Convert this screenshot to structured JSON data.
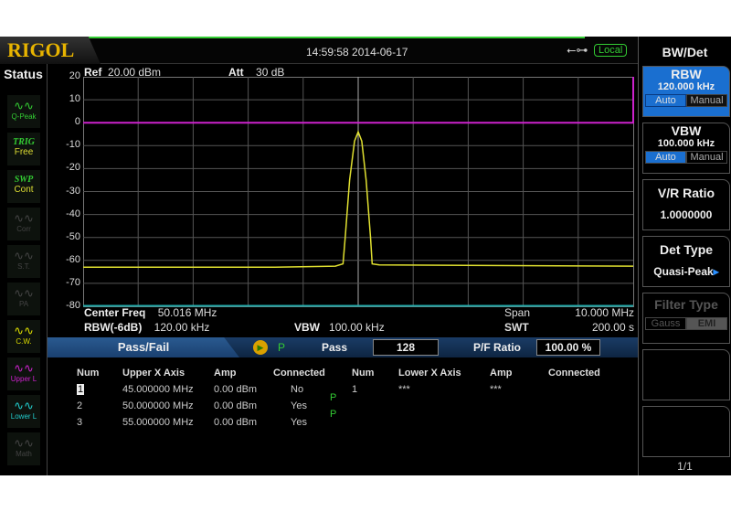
{
  "header": {
    "logo": "RIGOL",
    "datetime": "14:59:58  2014-06-17",
    "usb_icon": "usb-icon",
    "remote_status": "Local",
    "accent": "#33cc33"
  },
  "status": {
    "title": "Status",
    "items": [
      {
        "label": "Q-Peak",
        "icon": "quasi-peak-icon",
        "color": "#33cc33"
      },
      {
        "top": "TRIG",
        "label": "Free",
        "color": "#dddd33"
      },
      {
        "top": "SWP",
        "label": "Cont",
        "color": "#dddd33"
      },
      {
        "label": "Corr",
        "icon": "correction-icon",
        "color": "#444444"
      },
      {
        "label": "S.T.",
        "icon": "signal-track-icon",
        "color": "#444444"
      },
      {
        "label": "PA",
        "icon": "preamp-icon",
        "color": "#444444"
      },
      {
        "label": "C.W.",
        "icon": "trace-icon",
        "color": "#dddd00"
      },
      {
        "label": "Upper L",
        "icon": "trace-icon",
        "color": "#cc22cc"
      },
      {
        "label": "Lower L",
        "icon": "trace-icon",
        "color": "#22cccc"
      },
      {
        "label": "Math",
        "icon": "math-icon",
        "color": "#444444"
      }
    ]
  },
  "plot": {
    "ref_label": "Ref",
    "ref": "20.00 dBm",
    "att_label": "Att",
    "att": "30 dB",
    "y_ticks": [
      "20",
      "10",
      "0",
      "-10",
      "-20",
      "-30",
      "-40",
      "-50",
      "-60",
      "-70",
      "-80"
    ],
    "upper_limit_dbm": 0,
    "upper_color": "#cc22cc",
    "trace_color": "#e0e030",
    "lower_color": "#22aaaa",
    "trace": [
      [
        45.016,
        -63
      ],
      [
        48.5,
        -63
      ],
      [
        49.6,
        -62.5
      ],
      [
        49.74,
        -61.5
      ],
      [
        49.78,
        -50
      ],
      [
        49.86,
        -25
      ],
      [
        49.95,
        -8
      ],
      [
        50.016,
        -4
      ],
      [
        50.08,
        -8
      ],
      [
        50.16,
        -25
      ],
      [
        50.24,
        -50
      ],
      [
        50.27,
        -61.5
      ],
      [
        50.4,
        -62
      ],
      [
        55.016,
        -62.5
      ]
    ]
  },
  "info": {
    "center_label": "Center Freq",
    "center": "50.016 MHz",
    "span_label": "Span",
    "span": "10.000 MHz",
    "rbw_label": "RBW(-6dB)",
    "rbw": "120.00 kHz",
    "vbw_label": "VBW",
    "vbw": "100.00 kHz",
    "swt_label": "SWT",
    "swt": "200.00 s"
  },
  "passfail": {
    "title": "Pass/Fail",
    "run_icon": "play-icon",
    "result": "P",
    "pass_label": "Pass",
    "pass_count": "128",
    "ratio_label": "P/F Ratio",
    "ratio": "100.00 %",
    "upper_headers": [
      "Num",
      "Upper X Axis",
      "Amp",
      "Connected"
    ],
    "upper_rows": [
      [
        "1",
        "45.000000 MHz",
        "0.00 dBm",
        "No"
      ],
      [
        "2",
        "50.000000 MHz",
        "0.00 dBm",
        "Yes"
      ],
      [
        "3",
        "55.000000 MHz",
        "0.00 dBm",
        "Yes"
      ]
    ],
    "segment_results": [
      "P",
      "P"
    ],
    "lower_headers": [
      "Num",
      "Lower X Axis",
      "Amp",
      "Connected"
    ],
    "lower_rows": [
      [
        "1",
        "***",
        "***",
        ""
      ]
    ]
  },
  "menu": {
    "title": "BW/Det",
    "rbw": {
      "label": "RBW",
      "value": "120.000 kHz",
      "auto": "Auto",
      "manual": "Manual"
    },
    "vbw": {
      "label": "VBW",
      "value": "100.000 kHz",
      "auto": "Auto",
      "manual": "Manual"
    },
    "vr": {
      "label": "V/R Ratio",
      "value": "1.0000000"
    },
    "det": {
      "label": "Det Type",
      "value": "Quasi-Peak"
    },
    "filter": {
      "label": "Filter Type",
      "gauss": "Gauss",
      "emi": "EMI"
    },
    "page": "1/1",
    "highlight": "#1a6fd0"
  }
}
